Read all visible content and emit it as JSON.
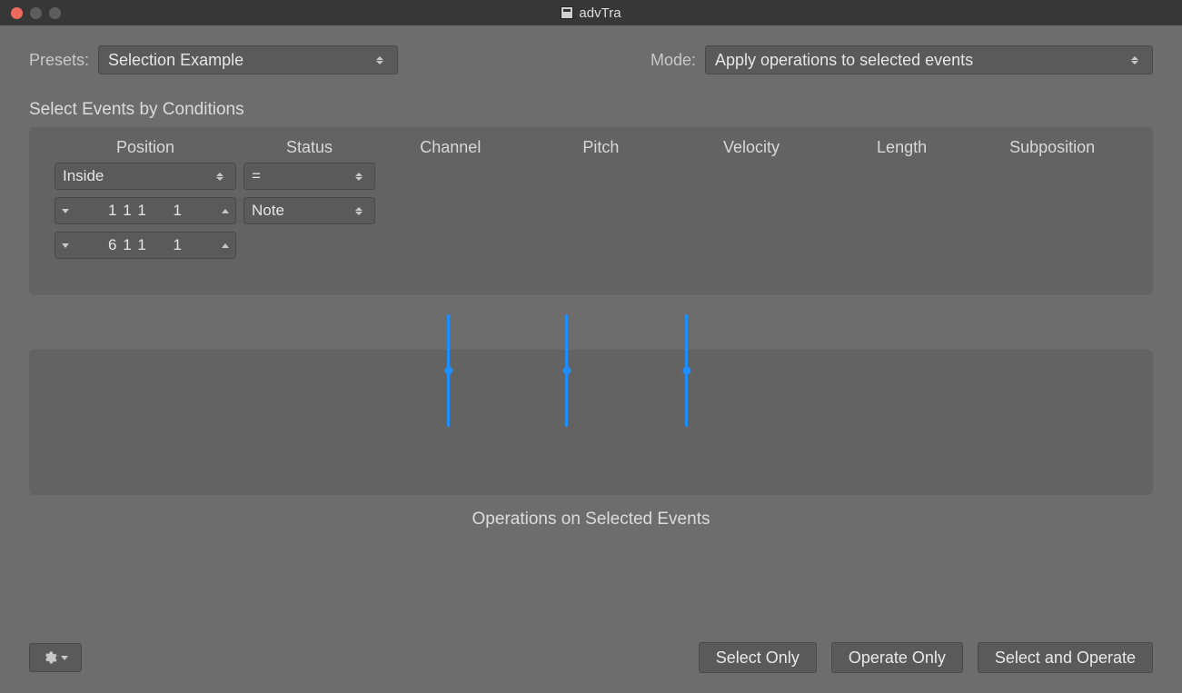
{
  "window": {
    "title": "advTra"
  },
  "toolbar": {
    "presets_label": "Presets:",
    "presets_value": "Selection Example",
    "mode_label": "Mode:",
    "mode_value": "Apply operations to selected events"
  },
  "conditions": {
    "section_label": "Select Events by Conditions",
    "columns": {
      "position": "Position",
      "status": "Status",
      "channel": "Channel",
      "pitch": "Pitch",
      "velocity": "Velocity",
      "length": "Length",
      "subposition": "Subposition"
    },
    "position_mode": "Inside",
    "position_value1": "1 1 1     1",
    "position_value2": "6 1 1     1",
    "status_op": "=",
    "status_type": "Note"
  },
  "operations": {
    "caption": "Operations on Selected Events"
  },
  "footer": {
    "select_only": "Select Only",
    "operate_only": "Operate Only",
    "select_and_operate": "Select and Operate"
  }
}
